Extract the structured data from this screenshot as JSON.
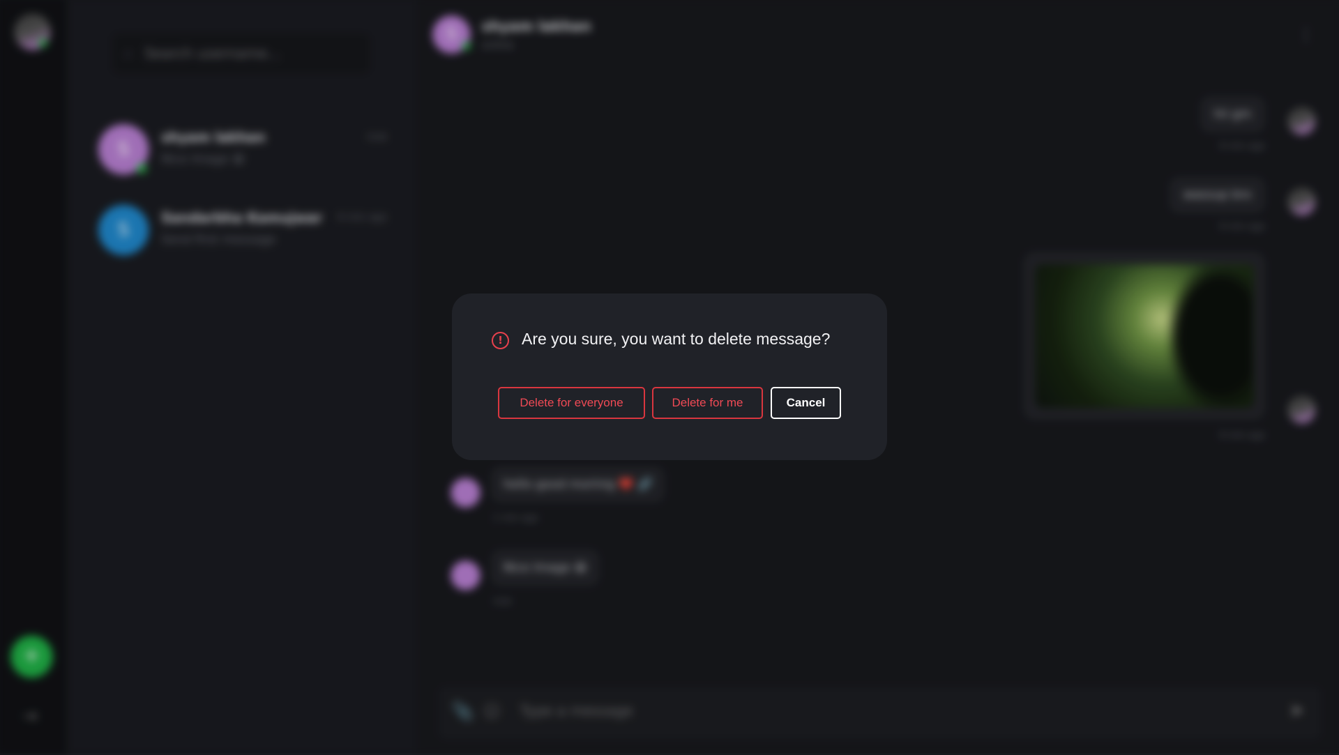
{
  "rail": {
    "add_icon": "+",
    "logout_icon": "⇥"
  },
  "sidebar": {
    "search_placeholder": "Search username...",
    "conversations": [
      {
        "initial": "S",
        "name": "shyam lakhan",
        "time": "now",
        "preview": "Nice Image 😀",
        "avatar_color": "#b67ed0",
        "online": true
      },
      {
        "initial": "S",
        "name": "Sandarbha Kamujwar",
        "time": "6 min ago",
        "preview": "Send first message",
        "avatar_color": "#1f86c9",
        "online": false
      }
    ]
  },
  "chat": {
    "header": {
      "initial": "S",
      "name": "shyam lakhan",
      "status": "online",
      "menu_icon": "⋮"
    },
    "messages_out": [
      {
        "text": "hii gm",
        "time": "6 min ago"
      },
      {
        "text": "wassup bro",
        "time": "6 min ago"
      }
    ],
    "image_message_time": "6 min ago",
    "messages_in": [
      {
        "text": "hello good morinig ❤️ 🔗",
        "time": "1 min ago"
      },
      {
        "text": "Nice Image 😀",
        "time": "now"
      }
    ],
    "composer": {
      "placeholder": "Type a message",
      "attach_icon": "📎",
      "emoji_icon": "☺",
      "send_icon": "➤"
    }
  },
  "modal": {
    "title": "Are you sure, you want to delete message?",
    "warning_icon": "!",
    "buttons": {
      "delete_everyone": "Delete for everyone",
      "delete_me": "Delete for me",
      "cancel": "Cancel"
    },
    "colors": {
      "danger": "#e8414d",
      "background": "#202228"
    }
  }
}
